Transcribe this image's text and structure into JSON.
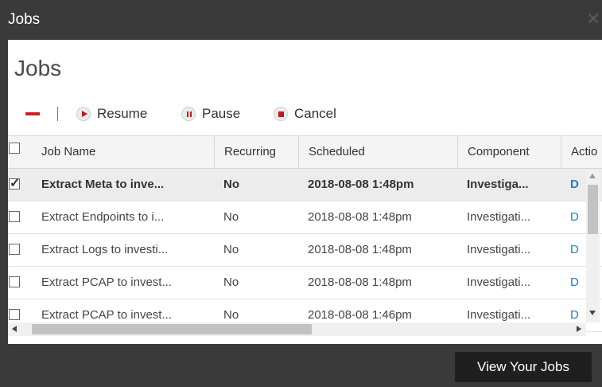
{
  "window": {
    "title": "Jobs",
    "close_icon": "close-icon"
  },
  "panel": {
    "title": "Jobs"
  },
  "toolbar": {
    "remove_icon": "minus-icon",
    "resume_label": "Resume",
    "pause_label": "Pause",
    "cancel_label": "Cancel",
    "accent_color": "#c8161d"
  },
  "table": {
    "columns": [
      "Job Name",
      "Recurring",
      "Scheduled",
      "Component",
      "Actio"
    ],
    "rows": [
      {
        "checked": true,
        "job_name": "Extract Meta to inve...",
        "recurring": "No",
        "scheduled": "2018-08-08 1:48pm",
        "component": "Investiga...",
        "action": "D"
      },
      {
        "checked": false,
        "job_name": "Extract Endpoints to i...",
        "recurring": "No",
        "scheduled": "2018-08-08 1:48pm",
        "component": "Investigati...",
        "action": "D"
      },
      {
        "checked": false,
        "job_name": "Extract Logs to investi...",
        "recurring": "No",
        "scheduled": "2018-08-08 1:48pm",
        "component": "Investigati...",
        "action": "D"
      },
      {
        "checked": false,
        "job_name": "Extract PCAP to invest...",
        "recurring": "No",
        "scheduled": "2018-08-08 1:48pm",
        "component": "Investigati...",
        "action": "D"
      },
      {
        "checked": false,
        "job_name": "Extract PCAP to invest...",
        "recurring": "No",
        "scheduled": "2018-08-08 1:46pm",
        "component": "Investigati...",
        "action": "D"
      }
    ]
  },
  "footer": {
    "view_jobs_label": "View Your Jobs"
  },
  "colors": {
    "background": "#3a3a3a",
    "link": "#1e7ec8",
    "selected_row": "#ececec"
  }
}
